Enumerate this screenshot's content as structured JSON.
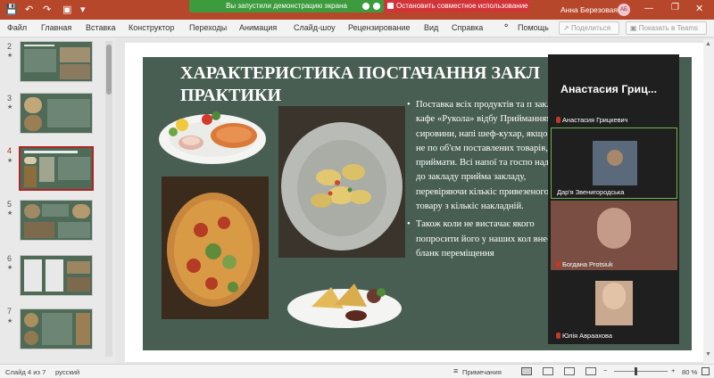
{
  "share": {
    "presenting_text": "Вы запустили демонстрацию экрана",
    "stop_text": "Остановить совместное использование"
  },
  "titlebar": {
    "user_name": "Анна Березовая",
    "user_initials": "АБ"
  },
  "menu": {
    "items": [
      "Файл",
      "Главная",
      "Вставка",
      "Конструктор",
      "Переходы",
      "Анимация",
      "Слайд-шоу",
      "Рецензирование",
      "Вид",
      "Справка"
    ],
    "help_label": "Помощь",
    "share_label": "Поделиться",
    "teams_label": "Показать в Teams"
  },
  "thumbnails": [
    {
      "num": "2",
      "star": "★"
    },
    {
      "num": "3",
      "star": "★"
    },
    {
      "num": "4",
      "star": "★"
    },
    {
      "num": "5",
      "star": "★"
    },
    {
      "num": "6",
      "star": "★"
    },
    {
      "num": "7",
      "star": "★"
    }
  ],
  "slide": {
    "title": "ХАРАКТЕРИСТИКА ПОСТАЧАННЯ ЗАКЛ ПРАКТИКИ",
    "bullets": [
      "Поставка всіх продуктів та п закладу кафе «Рукола» відбу Прийманням сировини, напі шеф-кухар, якщо йому не по об'єм поставлених товарів, в приймати. Всі напої та госпо надходять до закладу прийма закладу, перевіряючи кількіс привезеного товару з кількіс накладній.",
      "Також коли не вистачає якого попросити його у наших кол внести в бланк переміщення"
    ],
    "background_color": "#485e52"
  },
  "call": {
    "presenter_label": "Анастасия Гриц...",
    "participants": [
      {
        "name": "Анастасия Грицкевич"
      },
      {
        "name": "Дар'я Звенигородська"
      },
      {
        "name": "Богдана Protsiuk"
      },
      {
        "name": "Юлія Авраахова"
      }
    ]
  },
  "status": {
    "slide_counter": "Слайд 4 из 7",
    "language": "русский",
    "notes_label": "Примечания",
    "zoom": "80 %"
  }
}
